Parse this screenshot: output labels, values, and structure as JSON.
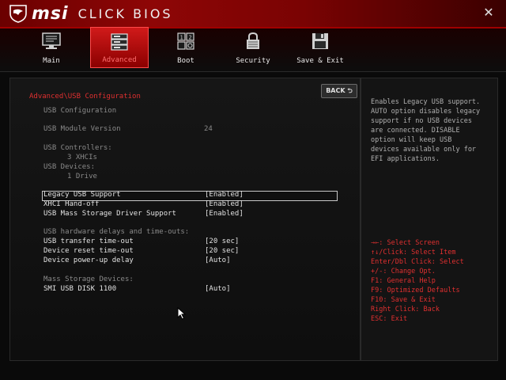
{
  "app": {
    "brand": "msi",
    "title": "CLICK BIOS",
    "close_glyph": "✕",
    "accent_color": "#e03030"
  },
  "tabs": [
    {
      "label": "Main",
      "icon": "monitor-icon",
      "active": false
    },
    {
      "label": "Advanced",
      "icon": "server-icon",
      "active": true
    },
    {
      "label": "Boot",
      "icon": "boot-icon",
      "active": false
    },
    {
      "label": "Security",
      "icon": "lock-icon",
      "active": false
    },
    {
      "label": "Save & Exit",
      "icon": "floppy-icon",
      "active": false
    }
  ],
  "main": {
    "breadcrumb": "Advanced\\USB Configuration",
    "back_label": "BACK",
    "back_glyph": "⮌",
    "section_title": "USB Configuration",
    "module_version_label": "USB Module Version",
    "module_version_value": "24",
    "controllers_label": "USB Controllers:",
    "controllers_value": "3 XHCIs",
    "devices_label": "USB Devices:",
    "devices_value": "1 Drive",
    "settings": [
      {
        "label": "Legacy USB Support",
        "value": "[Enabled]",
        "selected": true
      },
      {
        "label": "XHCI Hand-off",
        "value": "[Enabled]",
        "selected": false
      },
      {
        "label": "USB Mass Storage Driver Support",
        "value": "[Enabled]",
        "selected": false
      }
    ],
    "timeouts_heading": "USB hardware delays and time-outs:",
    "timeouts": [
      {
        "label": "USB transfer time-out",
        "value": "[20 sec]"
      },
      {
        "label": "Device reset time-out",
        "value": "[20 sec]"
      },
      {
        "label": "Device power-up delay",
        "value": "[Auto]"
      }
    ],
    "mass_storage_heading": "Mass Storage Devices:",
    "mass_storage": [
      {
        "label": "SMI USB DISK 1100",
        "value": "[Auto]"
      }
    ]
  },
  "help": {
    "description": "Enables Legacy USB support.\nAUTO option disables legacy\nsupport if no USB devices\nare connected. DISABLE\noption will keep USB\ndevices available only for\nEFI applications.",
    "keys": [
      "→←: Select Screen",
      "↑↓/Click: Select Item",
      "Enter/Dbl Click: Select",
      "+/-: Change Opt.",
      "F1: General Help",
      "F9: Optimized Defaults",
      "F10: Save & Exit",
      "Right Click: Back",
      "ESC: Exit"
    ]
  }
}
